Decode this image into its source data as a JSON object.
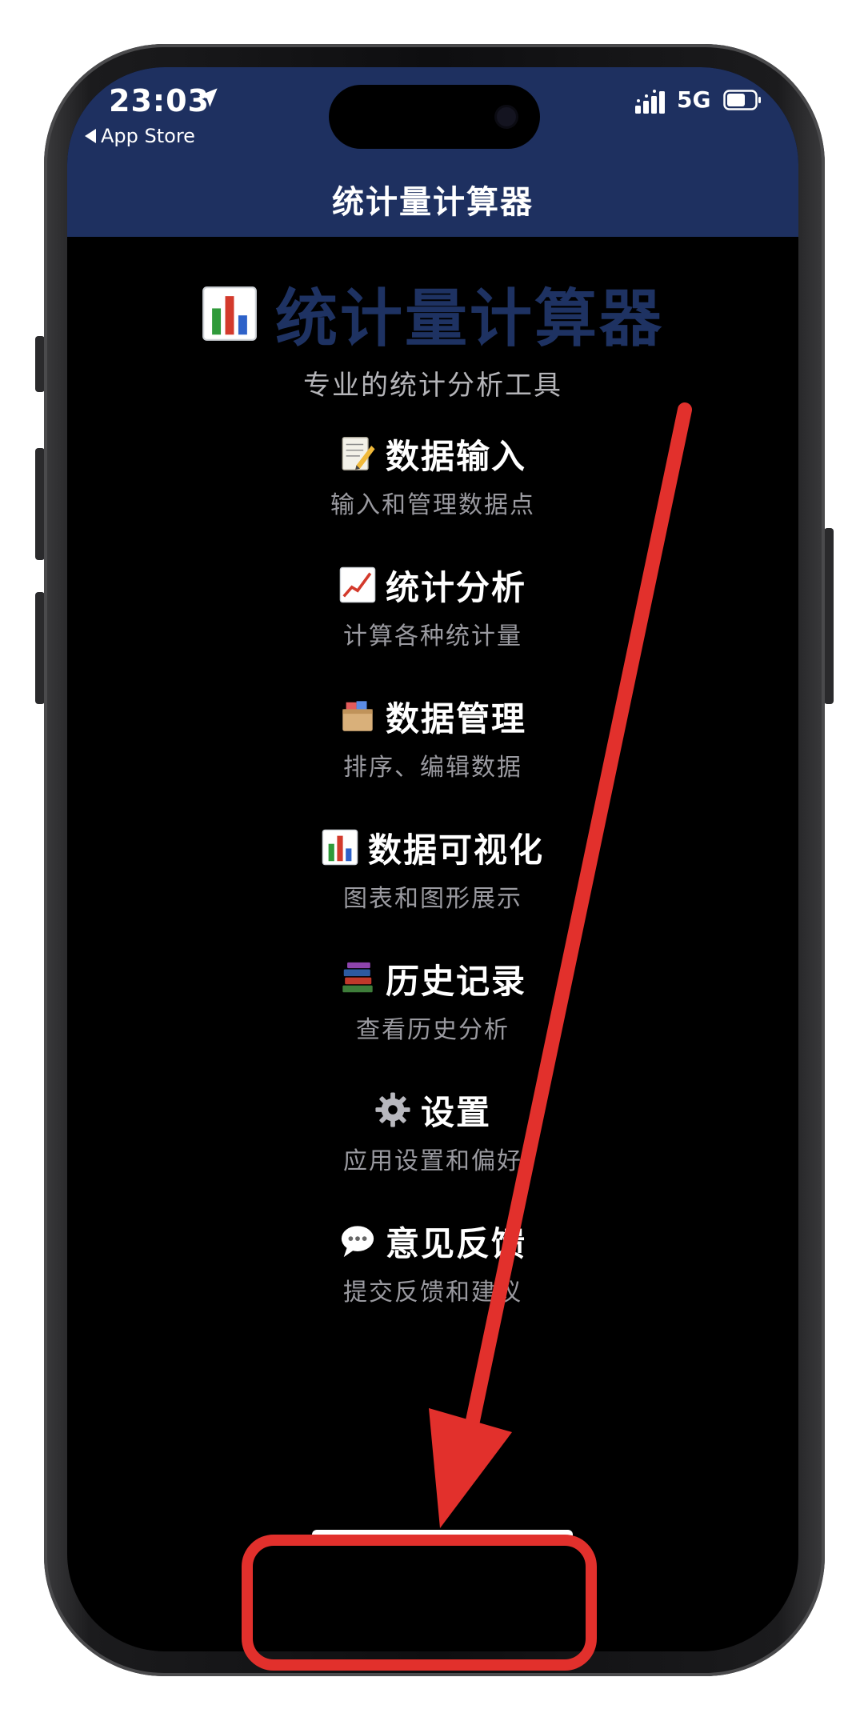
{
  "status_bar": {
    "time": "23:03",
    "back_app": "App Store",
    "network": "5G",
    "location_icon": "location-arrow-icon",
    "signal_icon": "cellular-signal-icon",
    "battery_icon": "battery-icon"
  },
  "header": {
    "title": "统计量计算器"
  },
  "hero": {
    "icon": "bar-chart-icon",
    "title": "统计量计算器",
    "subtitle": "专业的统计分析工具"
  },
  "menu": [
    {
      "icon": "memo-icon",
      "label": "数据输入",
      "desc": "输入和管理数据点"
    },
    {
      "icon": "trend-chart-icon",
      "label": "统计分析",
      "desc": "计算各种统计量"
    },
    {
      "icon": "file-box-icon",
      "label": "数据管理",
      "desc": "排序、编辑数据"
    },
    {
      "icon": "bar-chart-icon",
      "label": "数据可视化",
      "desc": "图表和图形展示"
    },
    {
      "icon": "books-icon",
      "label": "历史记录",
      "desc": "查看历史分析"
    },
    {
      "icon": "gear-icon",
      "label": "设置",
      "desc": "应用设置和偏好"
    },
    {
      "icon": "speech-bubble-icon",
      "label": "意见反馈",
      "desc": "提交反馈和建议"
    }
  ],
  "colors": {
    "header_bg": "#1e3060",
    "hero_title": "#1e3262",
    "annotation": "#e2302c"
  }
}
